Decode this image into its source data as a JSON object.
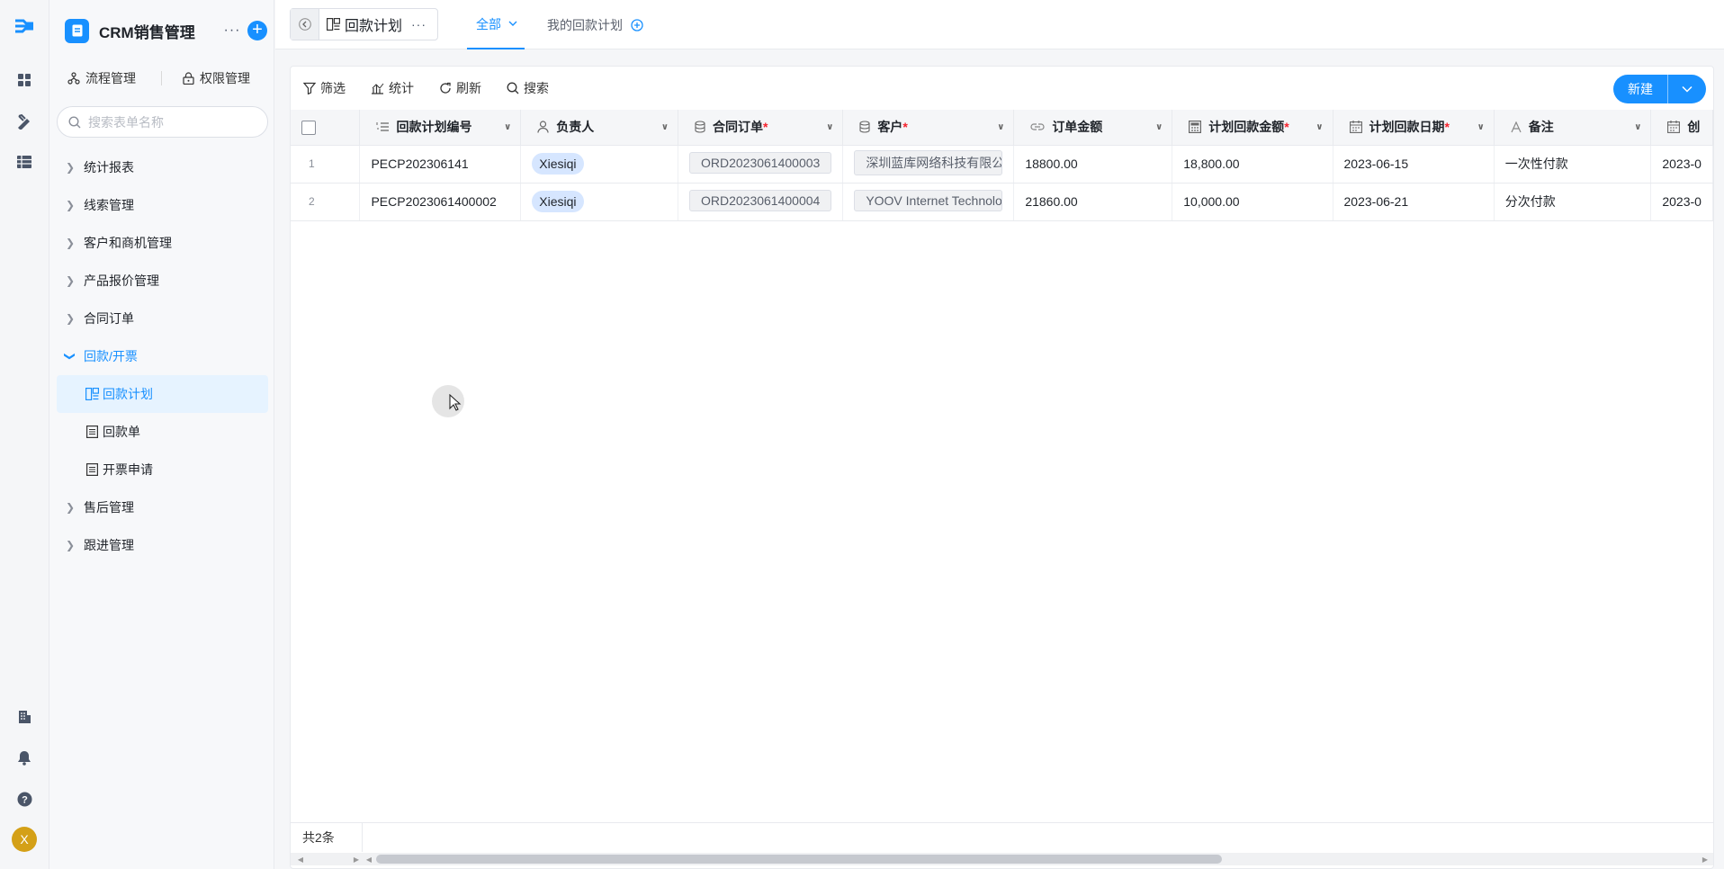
{
  "rail": {
    "avatar_letter": "X"
  },
  "app": {
    "title": "CRM销售管理",
    "more": "···",
    "add": "+"
  },
  "side_tools": {
    "workflow": "流程管理",
    "permissions": "权限管理"
  },
  "side_search": {
    "placeholder": "搜索表单名称"
  },
  "nav": {
    "items": [
      {
        "label": "统计报表"
      },
      {
        "label": "线索管理"
      },
      {
        "label": "客户和商机管理"
      },
      {
        "label": "产品报价管理"
      },
      {
        "label": "合同订单"
      },
      {
        "label": "回款/开票"
      }
    ],
    "sub_items": [
      {
        "label": "回款计划"
      },
      {
        "label": "回款单"
      },
      {
        "label": "开票申请"
      }
    ],
    "tail_items": [
      {
        "label": "售后管理"
      },
      {
        "label": "跟进管理"
      }
    ]
  },
  "topbar": {
    "title": "回款计划",
    "more": "···",
    "tab_all": "全部",
    "tab_mine": "我的回款计划"
  },
  "toolbar": {
    "filter": "筛选",
    "stats": "统计",
    "refresh": "刷新",
    "search": "搜索",
    "new": "新建"
  },
  "table": {
    "columns": [
      {
        "label": "回款计划编号",
        "required": ""
      },
      {
        "label": "负责人",
        "required": ""
      },
      {
        "label": "合同订单",
        "required": "*"
      },
      {
        "label": "客户",
        "required": "*"
      },
      {
        "label": "订单金额",
        "required": ""
      },
      {
        "label": "计划回款金额",
        "required": "*"
      },
      {
        "label": "计划回款日期",
        "required": "*"
      },
      {
        "label": "备注",
        "required": ""
      },
      {
        "label": "创",
        "required": ""
      }
    ],
    "rows": [
      {
        "index": "1",
        "code": "PECP202306141",
        "owner": "Xiesiqi",
        "order": "ORD2023061400003",
        "customer": "深圳蓝库网络科技有限公司",
        "amount": "18800.00",
        "plan_amount": "18,800.00",
        "plan_date": "2023-06-15",
        "note": "一次性付款",
        "created": "2023-0"
      },
      {
        "index": "2",
        "code": "PECP2023061400002",
        "owner": "Xiesiqi",
        "order": "ORD2023061400004",
        "customer": "YOOV Internet Technology",
        "amount": "21860.00",
        "plan_amount": "10,000.00",
        "plan_date": "2023-06-21",
        "note": "分次付款",
        "created": "2023-0"
      }
    ]
  },
  "footer": {
    "count": "共2条"
  },
  "colors": {
    "accent": "#1890ff",
    "active_bg": "#e6f3ff",
    "required": "#f5222d"
  }
}
